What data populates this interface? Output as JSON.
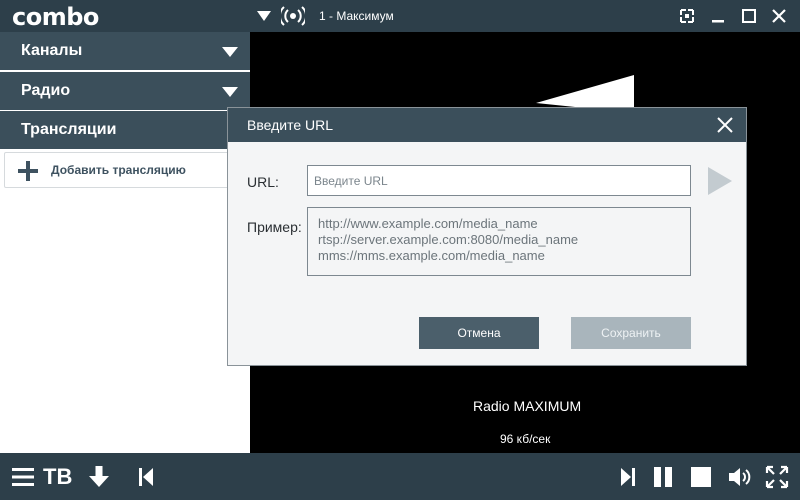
{
  "app": {
    "logo": "combo"
  },
  "topbar": {
    "station": "1 - Максимум"
  },
  "sidebar": {
    "sections": [
      {
        "label": "Каналы"
      },
      {
        "label": "Радио"
      },
      {
        "label": "Трансляции"
      }
    ],
    "add_stream": "Добавить трансляцию"
  },
  "player": {
    "station_name": "Radio MAXIMUM",
    "bitrate": "96 кб/сек"
  },
  "dialog": {
    "title": "Введите URL",
    "url_label": "URL:",
    "url_placeholder": "Введите URL",
    "url_value": "",
    "example_label": "Пример:",
    "examples": [
      "http://www.example.com/media_name",
      "rtsp://server.example.com:8080/media_name",
      "mms://mms.example.com/media_name"
    ],
    "cancel": "Отмена",
    "save": "Сохранить"
  },
  "bottombar": {
    "tv_label": "ТВ"
  },
  "colors": {
    "bar": "#2d3f4a",
    "section_header": "#3b4f5b",
    "cancel_button": "#4b5f6b",
    "save_button_disabled": "#a9b5bc"
  }
}
